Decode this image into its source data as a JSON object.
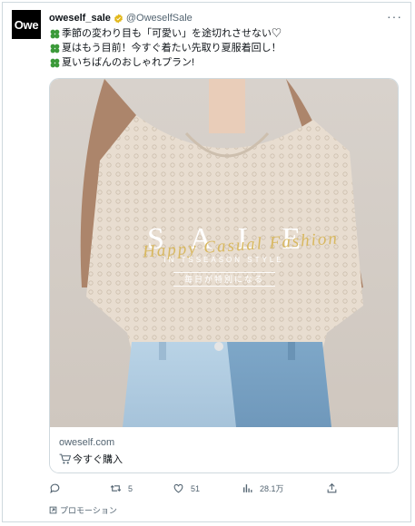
{
  "tweet": {
    "avatar_text": "Owe",
    "display_name": "oweself_sale",
    "handle": "@OweselfSale",
    "more_label": "···",
    "lines": [
      "季節の変わり目も「可愛い」を途切れさせない♡",
      "夏はもう目前！今すぐ着たい先取り夏服着回し！",
      "夏いちばんのおしゃれプラン!"
    ]
  },
  "card": {
    "image_overlay": {
      "title": "SALE",
      "script": "Happy Casual Fashion",
      "season": "IN TSSEASON STYLE",
      "banner": "毎日が特別になる"
    },
    "domain": "oweself.com",
    "cta": "今すぐ購入"
  },
  "actions": {
    "reply_count": "",
    "retweet_count": "5",
    "like_count": "51",
    "views_count": "28.1万"
  },
  "promo_label": "プロモーション",
  "colors": {
    "muted": "#536471",
    "text": "#0f1419",
    "border": "#cfd9de",
    "verified_gold": "#e2b719",
    "clover": "#3c9a3a"
  }
}
